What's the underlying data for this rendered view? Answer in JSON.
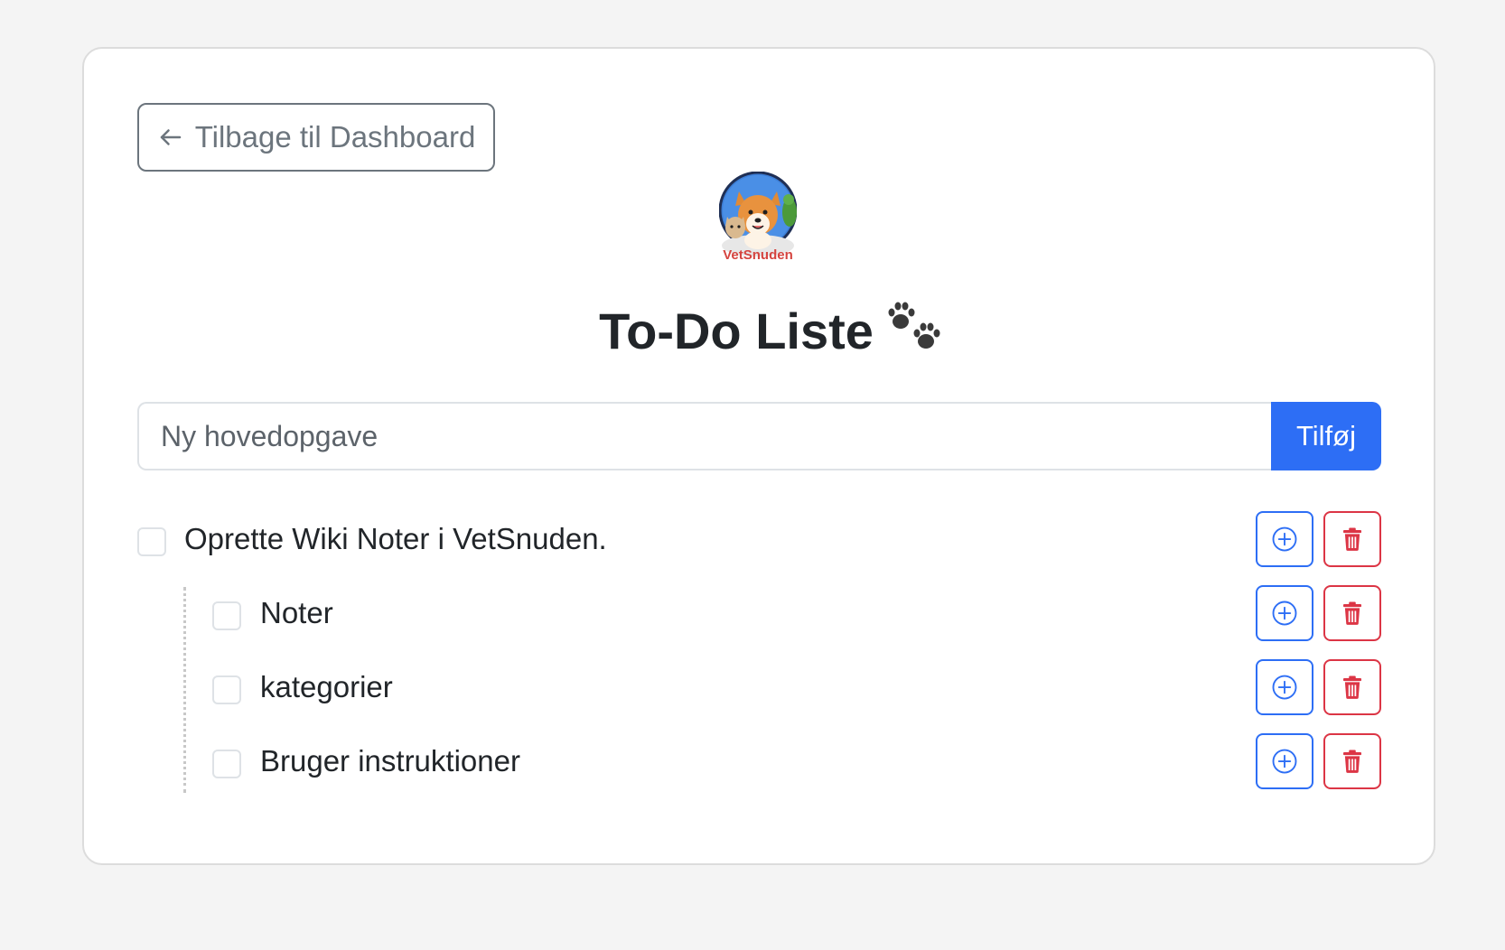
{
  "header": {
    "back_label": "Tilbage til Dashboard",
    "logo_text": "VetSnuden",
    "title": "To-Do Liste"
  },
  "new_task": {
    "placeholder": "Ny hovedopgave",
    "value": "",
    "add_label": "Tilføj"
  },
  "tasks": [
    {
      "label": "Oprette Wiki Noter i VetSnuden.",
      "checked": false,
      "level": 0
    },
    {
      "label": "Noter",
      "checked": false,
      "level": 1
    },
    {
      "label": "kategorier",
      "checked": false,
      "level": 1
    },
    {
      "label": "Bruger instruktioner",
      "checked": false,
      "level": 1
    }
  ],
  "icons": {
    "back": "arrow-left-icon",
    "title_decoration": "paw-prints-icon",
    "add_subtask": "plus-circle-icon",
    "delete": "trash-icon"
  },
  "colors": {
    "primary": "#2d6ef5",
    "danger": "#dc3545",
    "secondary": "#6c757d",
    "background": "#f4f4f4"
  }
}
